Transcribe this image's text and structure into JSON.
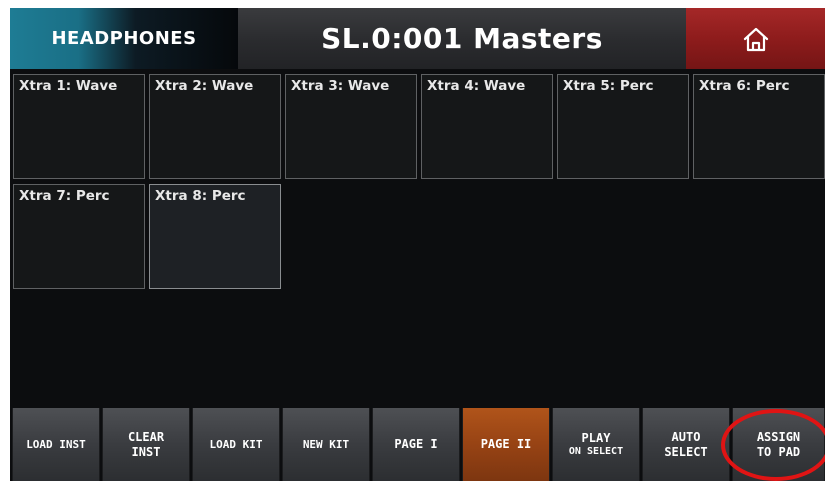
{
  "header": {
    "output_label": "HEADPHONES",
    "kit_title": "SL.0:001 Masters",
    "home_icon": "home-icon"
  },
  "pads": [
    {
      "label": "Xtra 1: Wave"
    },
    {
      "label": "Xtra 2: Wave"
    },
    {
      "label": "Xtra 3: Wave"
    },
    {
      "label": "Xtra 4: Wave"
    },
    {
      "label": "Xtra 5: Perc"
    },
    {
      "label": "Xtra 6: Perc"
    },
    {
      "label": "Xtra 7: Perc"
    },
    {
      "label": "Xtra 8: Perc",
      "selected": true
    }
  ],
  "toolbar": {
    "load_inst": "LOAD INST",
    "clear_inst_1": "CLEAR",
    "clear_inst_2": "INST",
    "load_kit": "LOAD KIT",
    "new_kit": "NEW KIT",
    "page_1": "PAGE I",
    "page_2": "PAGE II",
    "play_1": "PLAY",
    "play_2": "ON SELECT",
    "auto_1": "AUTO",
    "auto_2": "SELECT",
    "assign_1": "ASSIGN",
    "assign_2": "TO PAD"
  },
  "colors": {
    "accent_active": "#974314",
    "home_red": "#8e1c1c",
    "header_teal": "#1a6f86",
    "annotation_red": "#e01414"
  }
}
